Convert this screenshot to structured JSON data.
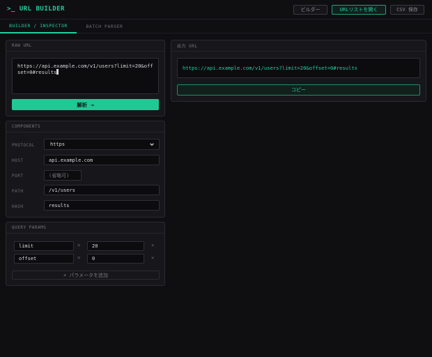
{
  "app": {
    "prompt": ">_",
    "title": "URL BUILDER"
  },
  "toolbar": {
    "builder": "ビルダー",
    "open_list": "URLリストを開く",
    "csv_save": "CSV 保存"
  },
  "tabs": [
    {
      "label": "BUILDER / INSPECTOR",
      "active": true
    },
    {
      "label": "BATCH PARSER",
      "active": false
    }
  ],
  "raw_url": {
    "header": "RAW URL",
    "value": "https://api.example.com/v1/users?limit=20&offset=0#results",
    "parse_label": "解析",
    "parse_icon": "→"
  },
  "output": {
    "header": "出力 URL",
    "value": "https://api.example.com/v1/users?limit=20&offset=0#results",
    "copy_label": "コピー"
  },
  "components": {
    "header": "COMPONENTS",
    "protocol_label": "PROTOCOL",
    "protocol_value": "https",
    "host_label": "HOST",
    "host_value": "api.example.com",
    "port_label": "PORT",
    "port_placeholder": "(省略可)",
    "path_label": "PATH",
    "path_value": "/v1/users",
    "hash_label": "HASH",
    "hash_value": "results"
  },
  "query": {
    "header": "QUERY PARAMS",
    "params": [
      {
        "key": "limit",
        "value": "20"
      },
      {
        "key": "offset",
        "value": "0"
      }
    ],
    "eq": "=",
    "remove": "×",
    "add_label": "パラメータを追加",
    "add_icon": "+"
  },
  "colors": {
    "accent": "#1fd1a0",
    "background": "#0f0f12",
    "panel": "#17171b"
  }
}
